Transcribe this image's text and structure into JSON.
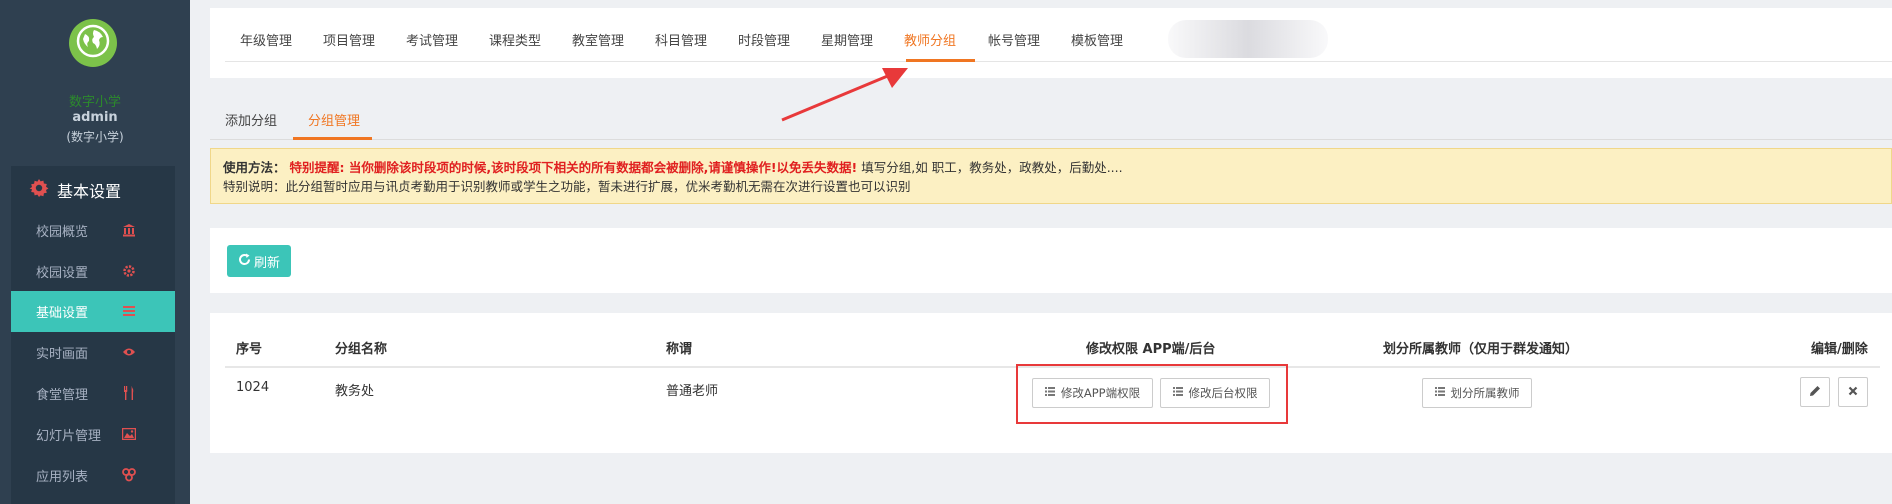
{
  "sidebar": {
    "logo_icon": "globe-icon",
    "school_name": "数字小学",
    "user_name": "admin",
    "user_school": "(数字小学)",
    "menu_header": "基本设置",
    "menu_header_icon": "gear-icon",
    "items": [
      {
        "label": "校园概览",
        "icon": "bank-icon"
      },
      {
        "label": "校园设置",
        "icon": "cog-icon"
      },
      {
        "label": "基础设置",
        "icon": "list-icon",
        "active": true
      },
      {
        "label": "实时画面",
        "icon": "eye-icon"
      },
      {
        "label": "食堂管理",
        "icon": "cutlery-icon"
      },
      {
        "label": "幻灯片管理",
        "icon": "picture-icon"
      },
      {
        "label": "应用列表",
        "icon": "apps-icon"
      }
    ]
  },
  "top_tabs": [
    "年级管理",
    "项目管理",
    "考试管理",
    "课程类型",
    "教室管理",
    "科目管理",
    "时段管理",
    "星期管理",
    "教师分组",
    "帐号管理",
    "模板管理"
  ],
  "top_tabs_active": "教师分组",
  "sub_tabs": [
    "添加分组",
    "分组管理"
  ],
  "sub_tabs_active": "分组管理",
  "notice": {
    "label": "使用方法：",
    "warning": "特别提醒: 当你删除该时段项的时候,该时段项下相关的所有数据都会被删除,请谨慎操作!以免丢失数据!",
    "usage": " 填写分组,如 职工，教务处，政教处，后勤处....",
    "special": "特别说明：此分组暂时应用与讯贞考勤用于识别教师或学生之功能，暂未进行扩展，优米考勤机无需在次进行设置也可以识别"
  },
  "refresh_label": "刷新",
  "table": {
    "headers": {
      "id": "序号",
      "name": "分组名称",
      "title": "称谓",
      "permissions": "修改权限 APP端/后台",
      "assign": "划分所属教师（仅用于群发通知）",
      "edit": "编辑/删除"
    },
    "rows": [
      {
        "id": "1024",
        "name": "教务处",
        "title": "普通老师",
        "app_perm_label": "修改APP端权限",
        "admin_perm_label": "修改后台权限",
        "assign_label": "划分所属教师"
      }
    ]
  },
  "colors": {
    "accent": "#f07622",
    "teal": "#3cc5b8",
    "sidebar": "#2f4050",
    "warning_red": "#e02020",
    "annotation_red": "#e8393a"
  }
}
